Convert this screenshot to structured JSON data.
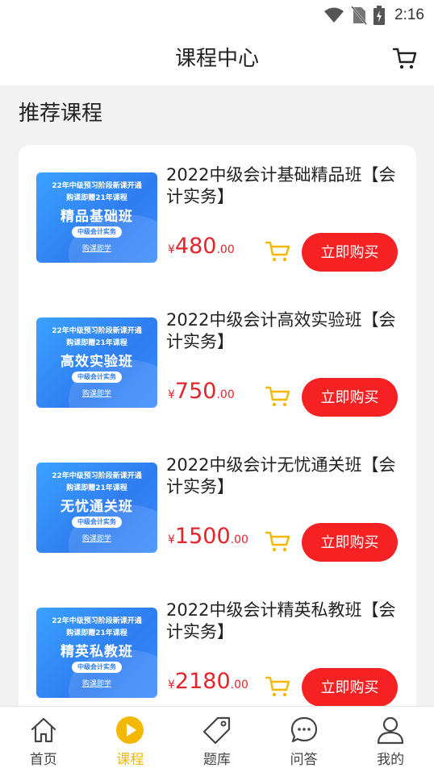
{
  "status_bar": {
    "time": "2:16",
    "icons": [
      "wifi-icon",
      "no-sim-icon",
      "battery-charging-icon"
    ]
  },
  "header": {
    "title": "课程中心",
    "cart_icon": "cart-icon"
  },
  "section": {
    "title": "推荐课程"
  },
  "colors": {
    "accent": "#f5b800",
    "price": "#e5242b",
    "buy_button": "#f52123",
    "thumb_blue": "#2f7cf0"
  },
  "courses": [
    {
      "thumb": {
        "line1": "22年中级预习阶段新课开通",
        "line2": "购课即赠21年课程",
        "name": "精品基础班",
        "tag": "中级会计实务",
        "link": "购课即学"
      },
      "title": "2022中级会计基础精品班【会计实务】",
      "price_symbol": "¥",
      "price_int": "480",
      "price_dec": ".00",
      "buy_label": "立即购买"
    },
    {
      "thumb": {
        "line1": "22年中级预习阶段新课开通",
        "line2": "购课即赠21年课程",
        "name": "高效实验班",
        "tag": "中级会计实务",
        "link": "购课即学"
      },
      "title": "2022中级会计高效实验班【会计实务】",
      "price_symbol": "¥",
      "price_int": "750",
      "price_dec": ".00",
      "buy_label": "立即购买"
    },
    {
      "thumb": {
        "line1": "22年中级预习阶段新课开通",
        "line2": "购课即赠21年课程",
        "name": "无忧通关班",
        "tag": "中级会计实务",
        "link": "购课即学"
      },
      "title": "2022中级会计无忧通关班【会计实务】",
      "price_symbol": "¥",
      "price_int": "1500",
      "price_dec": ".00",
      "buy_label": "立即购买"
    },
    {
      "thumb": {
        "line1": "22年中级预习阶段新课开通",
        "line2": "购课即赠21年课程",
        "name": "精英私教班",
        "tag": "中级会计实务",
        "link": "购课即学"
      },
      "title": "2022中级会计精英私教班【会计实务】",
      "price_symbol": "¥",
      "price_int": "2180",
      "price_dec": ".00",
      "buy_label": "立即购买"
    }
  ],
  "tabbar": {
    "items": [
      {
        "label": "首页",
        "icon": "home-icon",
        "active": false
      },
      {
        "label": "课程",
        "icon": "play-icon",
        "active": true
      },
      {
        "label": "题库",
        "icon": "tag-icon",
        "active": false
      },
      {
        "label": "问答",
        "icon": "chat-icon",
        "active": false
      },
      {
        "label": "我的",
        "icon": "user-icon",
        "active": false
      }
    ]
  }
}
